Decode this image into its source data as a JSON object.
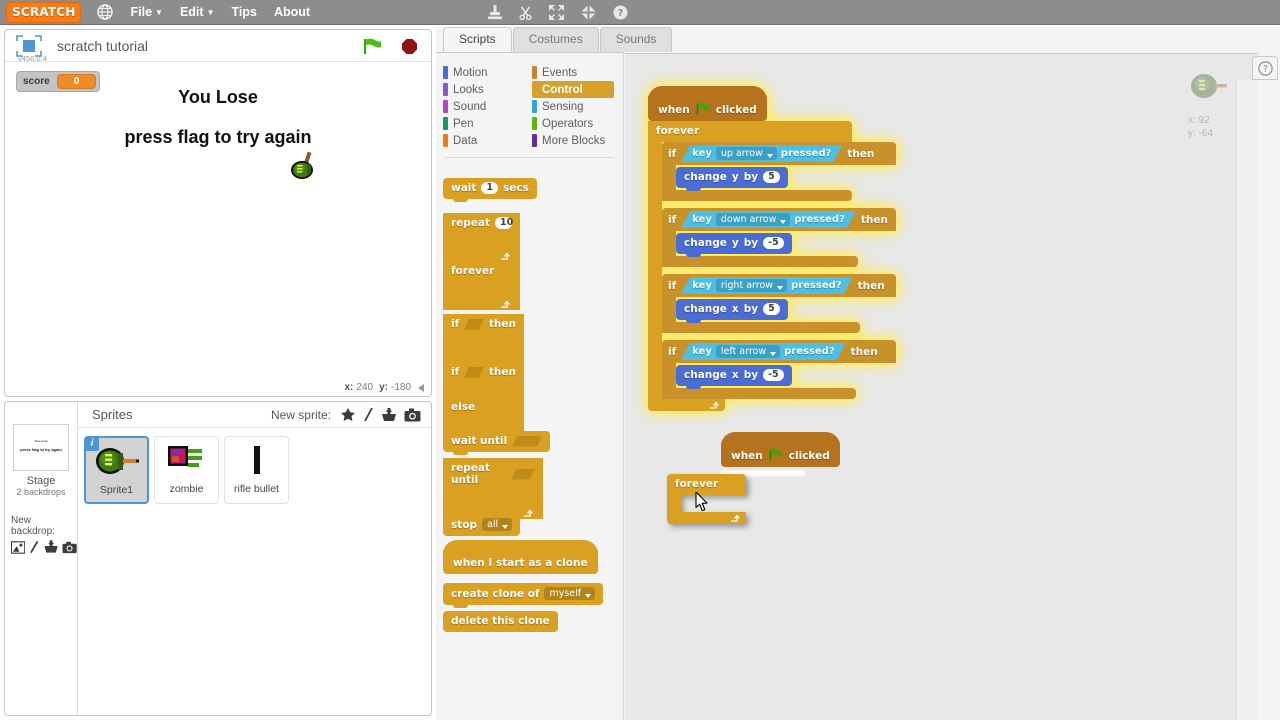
{
  "menubar": {
    "logo": "SCRATCH",
    "globe_icon": "globe-icon",
    "items": [
      {
        "label": "File",
        "caret": "▼"
      },
      {
        "label": "Edit",
        "caret": "▼"
      },
      {
        "label": "Tips",
        "caret": ""
      },
      {
        "label": "About",
        "caret": ""
      }
    ],
    "tools": [
      {
        "name": "duplicate-icon"
      },
      {
        "name": "cut-icon"
      },
      {
        "name": "grow-icon"
      },
      {
        "name": "shrink-icon"
      },
      {
        "name": "help-icon"
      }
    ]
  },
  "stage": {
    "project_title": "scratch tutorial",
    "version": "v456.0.4",
    "green_flag_icon": "green-flag-icon",
    "stop_icon": "stop-sign-icon",
    "monitor": {
      "name": "score",
      "value": "0"
    },
    "text_line_1": "You Lose",
    "text_line_2": "press flag to try again",
    "mouse_x_label": "x:",
    "mouse_x": "240",
    "mouse_y_label": "y:",
    "mouse_y": "-180"
  },
  "sprite_pane": {
    "stage_label": "Stage",
    "stage_info": "2 backdrops",
    "new_backdrop_label": "New backdrop:",
    "backdrop_icons": [
      "library-icon",
      "paint-icon",
      "upload-icon",
      "camera-icon"
    ],
    "header_title": "Sprites",
    "new_sprite_label": "New sprite:",
    "new_sprite_icons": [
      "library-icon",
      "paint-icon",
      "upload-icon",
      "camera-icon"
    ],
    "sprites": [
      {
        "name": "Sprite1",
        "selected": true,
        "badge": "i"
      },
      {
        "name": "zombie",
        "selected": false,
        "badge": ""
      },
      {
        "name": "rifle bullet",
        "selected": false,
        "badge": ""
      }
    ]
  },
  "scripts_panel": {
    "tabs": [
      {
        "label": "Scripts",
        "active": true
      },
      {
        "label": "Costumes",
        "active": false
      },
      {
        "label": "Sounds",
        "active": false
      }
    ],
    "categories_left": [
      {
        "label": "Motion",
        "color": "#4a6cd4"
      },
      {
        "label": "Looks",
        "color": "#8e55d0"
      },
      {
        "label": "Sound",
        "color": "#bb42c3"
      },
      {
        "label": "Pen",
        "color": "#0e9a6c"
      },
      {
        "label": "Data",
        "color": "#ee7d16"
      }
    ],
    "categories_right": [
      {
        "label": "Events",
        "color": "#c88330",
        "active": false
      },
      {
        "label": "Control",
        "color": "#e1a91a",
        "active": true
      },
      {
        "label": "Sensing",
        "color": "#2ca5e2",
        "active": false
      },
      {
        "label": "Operators",
        "color": "#5cb712",
        "active": false
      },
      {
        "label": "More Blocks",
        "color": "#632d99",
        "active": false
      }
    ],
    "palette_blocks": {
      "wait": {
        "pre": "wait",
        "num": "1",
        "post": "secs"
      },
      "repeat": {
        "label": "repeat",
        "num": "10"
      },
      "forever": {
        "label": "forever"
      },
      "if_then": {
        "pre": "if",
        "post": "then"
      },
      "if_else": {
        "pre": "if",
        "post": "then",
        "else": "else"
      },
      "wait_until": {
        "label": "wait until"
      },
      "repeat_until": {
        "label": "repeat until"
      },
      "stop": {
        "label": "stop",
        "field": "all"
      },
      "when_clone": {
        "label": "when I start as a clone"
      },
      "create_clone": {
        "pre": "create clone of",
        "field": "myself"
      },
      "delete_clone": {
        "label": "delete this clone"
      }
    },
    "help_button": "?"
  },
  "canvas": {
    "script_main": {
      "hat": {
        "pre": "when",
        "post": "clicked",
        "icon": "green-flag-icon"
      },
      "forever_label": "forever",
      "branches": [
        {
          "if": "if",
          "sense_pre": "key",
          "key": "up arrow",
          "sense_post": "pressed?",
          "then": "then",
          "action_pre": "change",
          "axis": "y",
          "by": "by",
          "value": "5"
        },
        {
          "if": "if",
          "sense_pre": "key",
          "key": "down arrow",
          "sense_post": "pressed?",
          "then": "then",
          "action_pre": "change",
          "axis": "y",
          "by": "by",
          "value": "-5"
        },
        {
          "if": "if",
          "sense_pre": "key",
          "key": "right arrow",
          "sense_post": "pressed?",
          "then": "then",
          "action_pre": "change",
          "axis": "x",
          "by": "by",
          "value": "5"
        },
        {
          "if": "if",
          "sense_pre": "key",
          "key": "left arrow",
          "sense_post": "pressed?",
          "then": "then",
          "action_pre": "change",
          "axis": "x",
          "by": "by",
          "value": "-5"
        }
      ]
    },
    "script_drag": {
      "hat": {
        "pre": "when",
        "post": "clicked",
        "icon": "green-flag-icon"
      },
      "forever_label": "forever"
    },
    "watermark": {
      "x_label": "x:",
      "x": "92",
      "y_label": "y:",
      "y": "-64"
    }
  },
  "colors": {
    "control": "#d9a022",
    "events": "#b5731d",
    "motion": "#4a6cd4",
    "sensing": "#4cbfe6",
    "accent_blue": "#4c97d3",
    "orange": "#fa7a18"
  }
}
